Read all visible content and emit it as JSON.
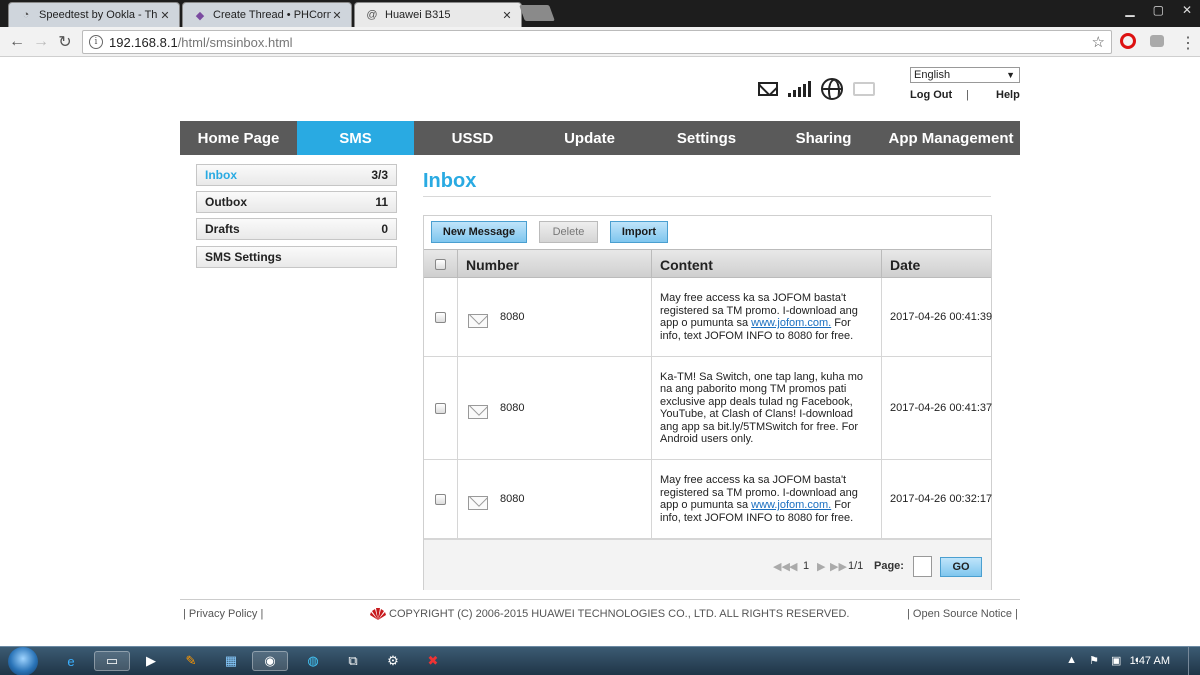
{
  "browser": {
    "tabs": [
      {
        "title": "Speedtest by Ookla - Th",
        "icon": "speedometer-icon"
      },
      {
        "title": "Create Thread • PHCorne",
        "icon": "phc-logo-icon"
      },
      {
        "title": "Huawei B315",
        "icon": "at-sign-icon",
        "active": true
      }
    ],
    "url_host": "192.168.8.1",
    "url_path": "/html/smsinbox.html"
  },
  "header": {
    "language": "English",
    "logout": "Log Out",
    "separator": "|",
    "help": "Help"
  },
  "nav": [
    "Home Page",
    "SMS",
    "USSD",
    "Update",
    "Settings",
    "Sharing",
    "App Management"
  ],
  "nav_active": "SMS",
  "sidebar": {
    "items": [
      {
        "label": "Inbox",
        "count": "3/3",
        "active": true
      },
      {
        "label": "Outbox",
        "count": "11"
      },
      {
        "label": "Drafts",
        "count": "0"
      },
      {
        "label": "SMS Settings",
        "count": ""
      }
    ]
  },
  "main": {
    "title": "Inbox",
    "buttons": {
      "new_message": "New Message",
      "delete": "Delete",
      "import": "Import"
    },
    "columns": [
      "Number",
      "Content",
      "Date"
    ],
    "messages": [
      {
        "number": "8080",
        "content_pre": "May free access ka sa JOFOM basta't registered sa TM promo. I-download ang app o pumunta sa ",
        "content_link": "www.jofom.com.",
        "content_post": " For info, text JOFOM INFO to 8080 for free.",
        "date": "2017-04-26 00:41:39"
      },
      {
        "number": "8080",
        "content_pre": "Ka-TM! Sa Switch, one tap lang, kuha mo na ang paborito mong TM promos pati exclusive app deals tulad ng Facebook, YouTube, at Clash of Clans! I-download ang app sa bit.ly/5TMSwitch for free. For Android users only.",
        "content_link": "",
        "content_post": "",
        "date": "2017-04-26 00:41:37"
      },
      {
        "number": "8080",
        "content_pre": "May free access ka sa JOFOM basta't registered sa TM promo. I-download ang app o pumunta sa ",
        "content_link": "www.jofom.com.",
        "content_post": " For info, text JOFOM INFO to 8080 for free.",
        "date": "2017-04-26 00:32:17"
      }
    ],
    "pager": {
      "current": "1",
      "summary": "1/1",
      "page_label": "Page:",
      "go": "GO"
    }
  },
  "footer": {
    "privacy": "Privacy Policy",
    "copyright": "COPYRIGHT (C) 2006-2015 HUAWEI TECHNOLOGIES CO., LTD. ALL RIGHTS RESERVED.",
    "open_source": "Open Source Notice"
  },
  "taskbar": {
    "clock": "1:47 AM"
  },
  "colors": {
    "accent": "#29aae2",
    "nav_bg": "#5a5a5a"
  }
}
